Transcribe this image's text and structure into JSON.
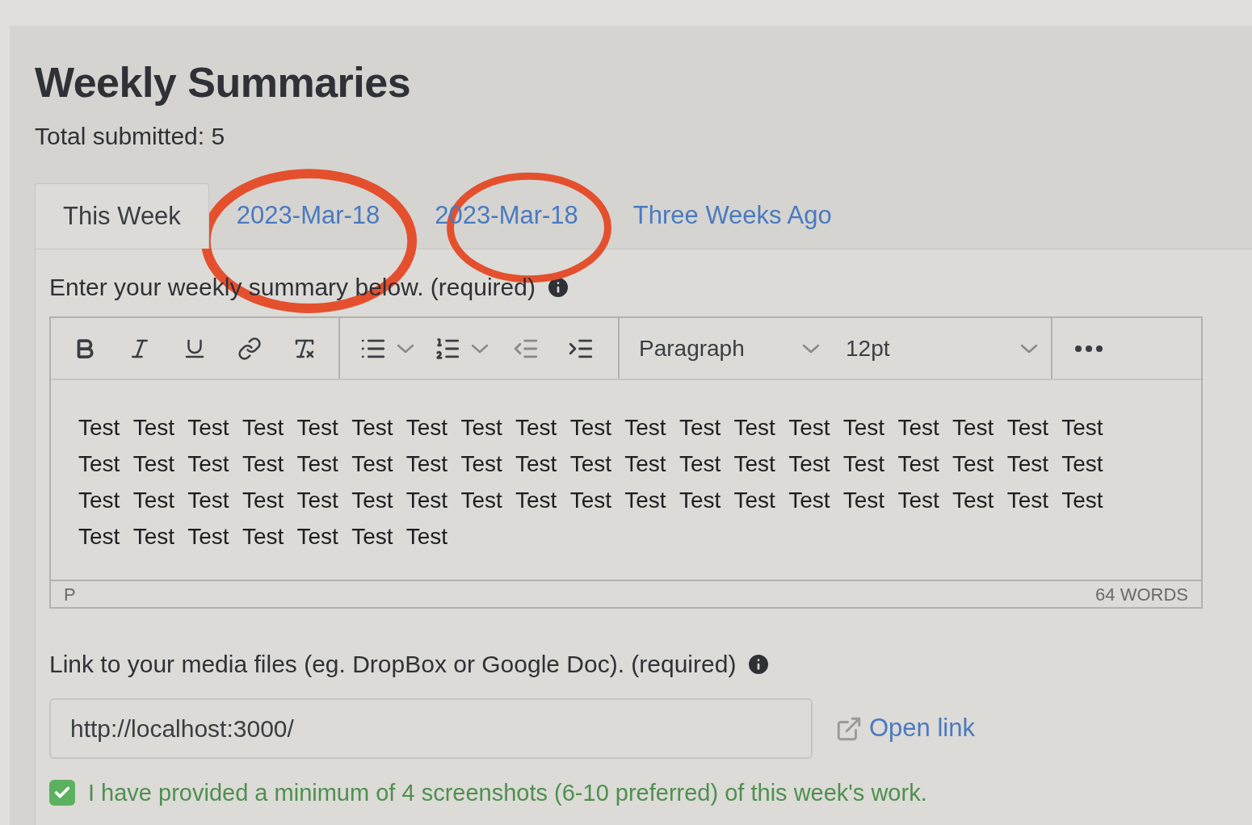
{
  "page": {
    "title": "Weekly Summaries",
    "total": "Total submitted: 5"
  },
  "tabs": [
    {
      "label": "This Week",
      "selected": true
    },
    {
      "label": "2023-Mar-18",
      "selected": false
    },
    {
      "label": "2023-Mar-18",
      "selected": false
    },
    {
      "label": "Three Weeks Ago",
      "selected": false
    }
  ],
  "summary": {
    "label": "Enter your weekly summary below. (required)",
    "format": "Paragraph",
    "size": "12pt",
    "body": "Test Test Test Test Test Test Test Test Test Test Test Test Test Test Test Test Test Test Test Test Test Test Test Test Test Test Test Test Test Test Test Test Test Test Test Test Test Test Test Test Test Test Test Test Test Test Test Test Test Test Test Test Test Test Test Test Test Test Test Test Test Test Test Test",
    "path": "P",
    "word_count": "64 WORDS"
  },
  "media": {
    "label": "Link to your media files (eg. DropBox or Google Doc). (required)",
    "value": "http://localhost:3000/",
    "open_link": "Open link"
  },
  "confirm": {
    "label": "I have provided a minimum of 4 screenshots (6-10 preferred) of this week's work.",
    "checked": true
  }
}
